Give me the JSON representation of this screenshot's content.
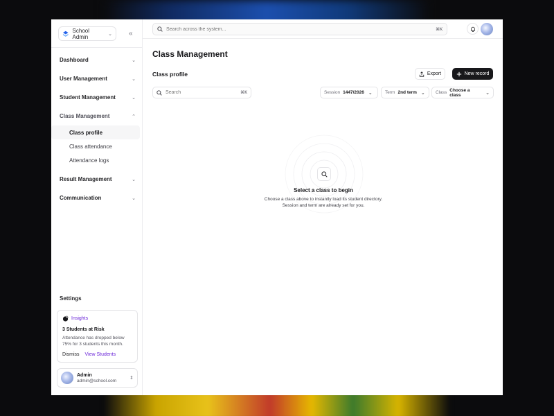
{
  "workspace": {
    "name": "School Admin"
  },
  "nav": {
    "items": [
      {
        "label": "Dashboard"
      },
      {
        "label": "User Management"
      },
      {
        "label": "Student Management"
      },
      {
        "label": "Class Management"
      },
      {
        "label": "Result Management"
      },
      {
        "label": "Communication"
      }
    ],
    "class_sub": [
      {
        "label": "Class profile"
      },
      {
        "label": "Class attendance"
      },
      {
        "label": "Attendance logs"
      }
    ]
  },
  "settings": {
    "label": "Settings"
  },
  "insights": {
    "label": "Insights",
    "title": "3 Students at Risk",
    "body": "Attendance has dropped below 75% for 3 students this month.",
    "dismiss": "Dismiss",
    "action": "View Students"
  },
  "user": {
    "name": "Admin",
    "email": "admin@school.com"
  },
  "search": {
    "placeholder": "Search across the system...",
    "shortcut": "⌘K"
  },
  "page": {
    "title": "Class Management",
    "section": "Class profile",
    "export_label": "Export",
    "new_label": "New record"
  },
  "table_search": {
    "placeholder": "Search",
    "shortcut": "⌘K"
  },
  "filters": {
    "session": {
      "label": "Session",
      "value": "1447/2026"
    },
    "term": {
      "label": "Term",
      "value": "2nd term"
    },
    "class": {
      "label": "Class",
      "value": "Choose a class"
    }
  },
  "empty_state": {
    "title": "Select a class to begin",
    "description": "Choose a class above to instantly load its student directory. Session and term are already set for you."
  },
  "colors": {
    "accent": "#6d28d9",
    "primary": "#18181b",
    "logo": "#2563eb"
  }
}
